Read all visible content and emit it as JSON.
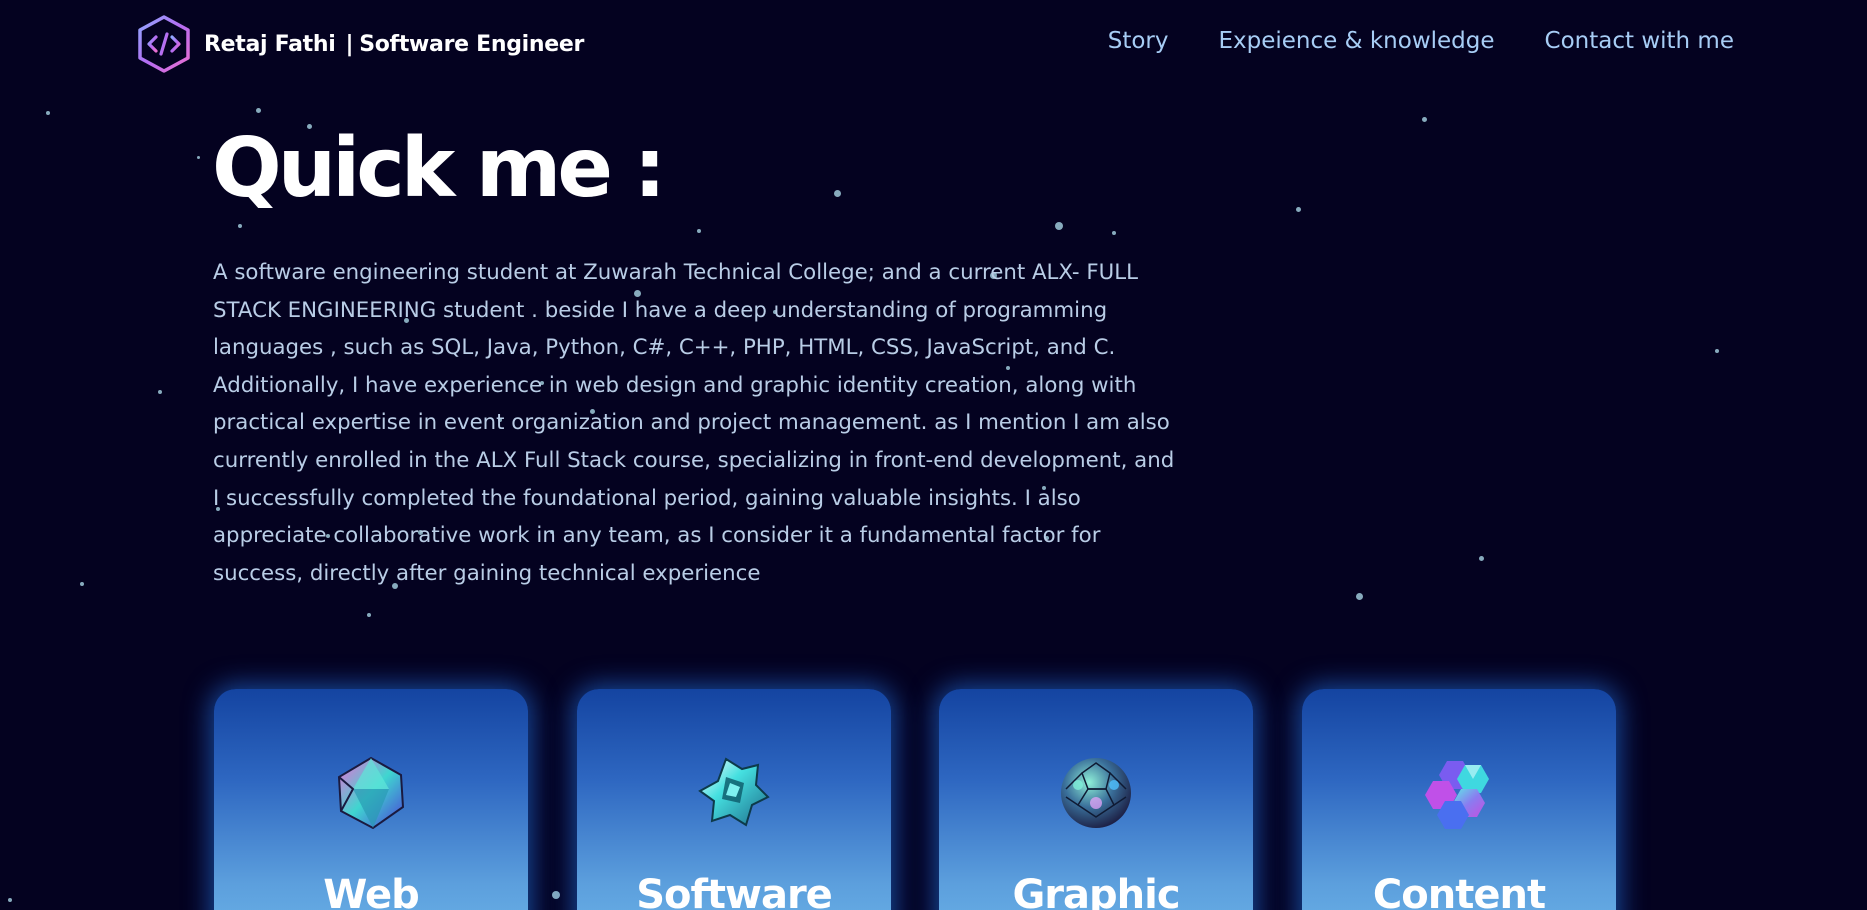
{
  "header": {
    "logo_icon": "code-hexagon-icon",
    "brand_name": "Retaj Fathi",
    "brand_separator": "|",
    "brand_role": "Software Engineer"
  },
  "nav": {
    "items": [
      {
        "label": "Story"
      },
      {
        "label": "Expeience & knowledge"
      },
      {
        "label": "Contact with me"
      }
    ]
  },
  "hero": {
    "title": "Quick me :",
    "paragraph": "A software engineering student at Zuwarah Technical College; and a current ALX- FULL STACK ENGINEERING student . beside I have a deep understanding of programming languages , such as SQL, Java, Python, C#, C++, PHP, HTML, CSS, JavaScript, and C. Additionally, I have experience in web design and graphic identity creation, along with practical expertise in event organization and project management. as I mention I am also currently enrolled in the ALX Full Stack course, specializing in front-end development, and I successfully completed the foundational period, gaining valuable insights. I also appreciate collaborative work in any team, as I consider it a fundamental factor for success, directly after gaining technical experience"
  },
  "cards": [
    {
      "title": "Web",
      "icon": "crystal-icosahedron-icon"
    },
    {
      "title": "Software",
      "icon": "crystal-star-icon"
    },
    {
      "title": "Graphic",
      "icon": "crystal-sphere-icon"
    },
    {
      "title": "Content",
      "icon": "crystal-cluster-icon"
    }
  ],
  "colors": {
    "background": "#040220",
    "nav_link": "#a7cdf5",
    "body_text": "#b9cde6",
    "card_top": "#1444a1",
    "card_bottom": "#6cb4e8",
    "star": "#9fc9d9"
  }
}
